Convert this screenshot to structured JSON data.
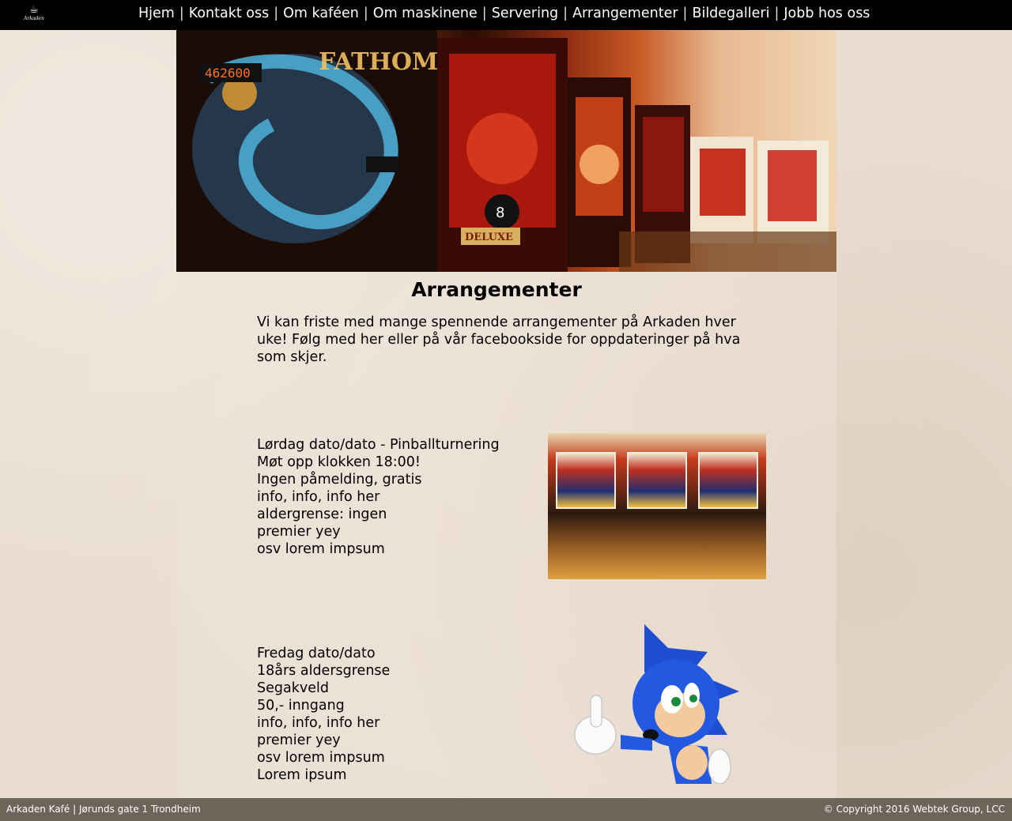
{
  "header": {
    "logo_text": "Arkaden",
    "nav": [
      {
        "label": "Hjem"
      },
      {
        "label": "Kontakt oss"
      },
      {
        "label": "Om kaféen"
      },
      {
        "label": "Om maskinene"
      },
      {
        "label": "Servering"
      },
      {
        "label": "Arrangementer"
      },
      {
        "label": "Bildegalleri"
      },
      {
        "label": "Jobb hos oss"
      }
    ],
    "separator": "|"
  },
  "page": {
    "title": "Arrangementer",
    "intro": "Vi kan friste med mange spennende arrangementer på Arkaden hver uke! Følg med her eller på vår facebookside for oppdateringer på hva som skjer."
  },
  "events": [
    {
      "lines": [
        "Lørdag dato/dato - Pinballturnering",
        "Møt opp klokken 18:00!",
        "Ingen påmelding, gratis",
        "info, info, info her",
        "aldergrense: ingen",
        "premier yey",
        "osv lorem impsum"
      ]
    },
    {
      "lines": [
        "Fredag dato/dato",
        "18års aldersgrense",
        "Segakveld",
        "50,- inngang",
        "info, info, info her",
        "premier yey",
        "osv lorem impsum",
        "Lorem ipsum"
      ]
    }
  ],
  "footer": {
    "left": "Arkaden Kafé | Jørunds gate 1 Trondheim",
    "right": "© Copyright 2016 Webtek Group, LCC"
  },
  "colors": {
    "topbar": "#000000",
    "footer": "#6e6459",
    "page_bg": "#e9ddd0"
  }
}
